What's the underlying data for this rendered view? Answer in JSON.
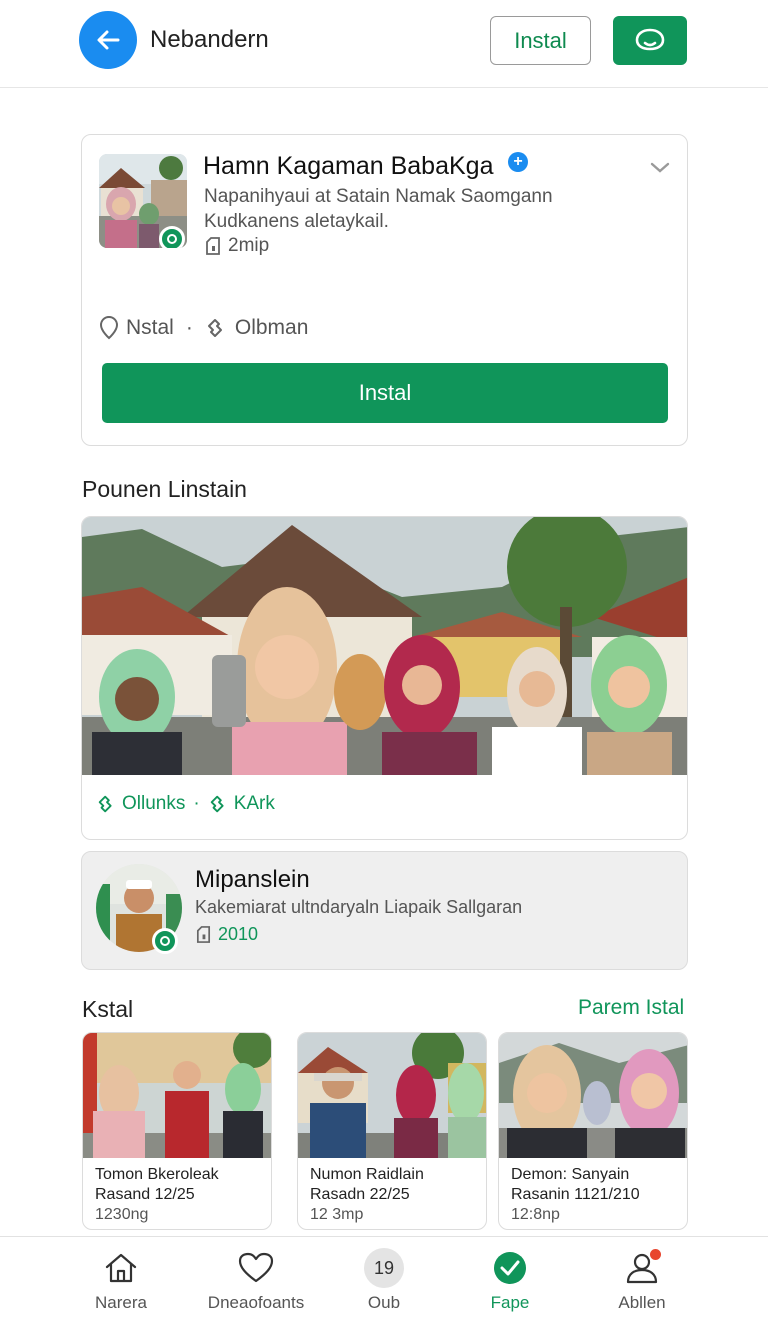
{
  "header": {
    "title": "Nebandern",
    "install_label": "Instal"
  },
  "app": {
    "name": "Hamn Kagaman BabaKga",
    "badge": "+",
    "description": "Napanihyaui at Satain Namak Saomgann Kudkanens aletaykail.",
    "size": "2mip",
    "meta_location": "Nstal",
    "meta_separator": "·",
    "meta_category": "Olbman",
    "install_label": "Instal"
  },
  "featured": {
    "section_title": "Pounen Linstain",
    "tag_1": "Ollunks",
    "tag_separator": "·",
    "tag_2": "KArk"
  },
  "promo": {
    "title": "Mipanslein",
    "description": "Kakemiarat ultndaryaln Liapaik Sallgaran",
    "year": "2010"
  },
  "more": {
    "section_title": "Kstal",
    "see_all": "Parem Istal",
    "items": [
      {
        "name": "Tomon Bkeroleak",
        "date": "Rasand 12/25",
        "size": "1230ng"
      },
      {
        "name": "Numon Raidlain",
        "date": "Rasadn 22/25",
        "size": "12 3mp"
      },
      {
        "name": "Demon: Sanyain",
        "date": "Rasanin 1121/210",
        "size": "12:8np"
      }
    ]
  },
  "bottom_nav": {
    "items": [
      {
        "label": "Narera",
        "icon": "home-icon"
      },
      {
        "label": "Dneaofoants",
        "icon": "heart-icon"
      },
      {
        "label": "Oub",
        "icon": "count-icon",
        "count": "19"
      },
      {
        "label": "Fape",
        "icon": "check-circle-icon",
        "active": true
      },
      {
        "label": "Abllen",
        "icon": "user-icon",
        "notification": true
      }
    ]
  },
  "colors": {
    "primary_green": "#10955a",
    "accent_blue": "#1a8cf0",
    "notification_red": "#e8452e"
  }
}
